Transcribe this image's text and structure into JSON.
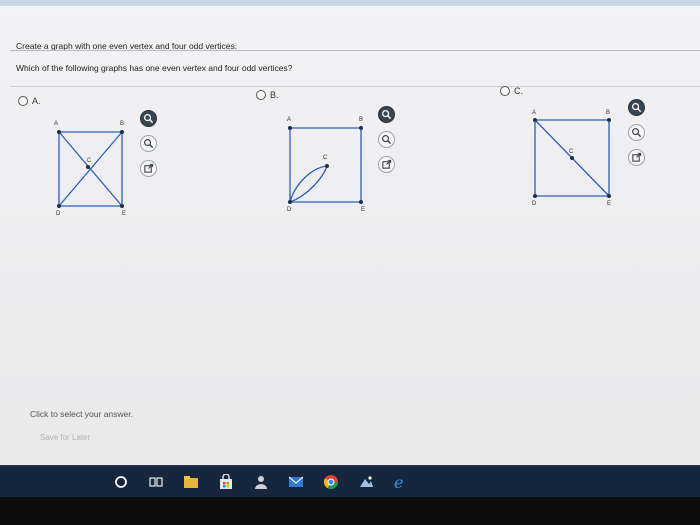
{
  "question": {
    "prompt": "Create a graph with one even vertex and four odd vertices.",
    "text": "Which of the following graphs has one even vertex and four odd vertices?"
  },
  "options": [
    {
      "label": "A.",
      "vertices": [
        "A",
        "B",
        "C",
        "D",
        "E"
      ]
    },
    {
      "label": "B.",
      "vertices": [
        "A",
        "B",
        "C",
        "D",
        "E"
      ]
    },
    {
      "label": "C.",
      "vertices": [
        "A",
        "B",
        "C",
        "D",
        "E"
      ]
    }
  ],
  "footer": {
    "click_text": "Click to select your answer.",
    "save_later": "Save for Later"
  },
  "tools": [
    "zoom-in-icon",
    "zoom-out-icon",
    "popout-icon"
  ],
  "taskbar": [
    "cortana-icon",
    "task-view-icon",
    "file-explorer-icon",
    "store-icon",
    "people-icon",
    "mail-icon",
    "chrome-icon",
    "photos-icon",
    "edge-icon"
  ],
  "colors": {
    "graph_line": "#2e5dbd",
    "vertex": "#1f2f4a",
    "taskbar": "#16273d"
  }
}
